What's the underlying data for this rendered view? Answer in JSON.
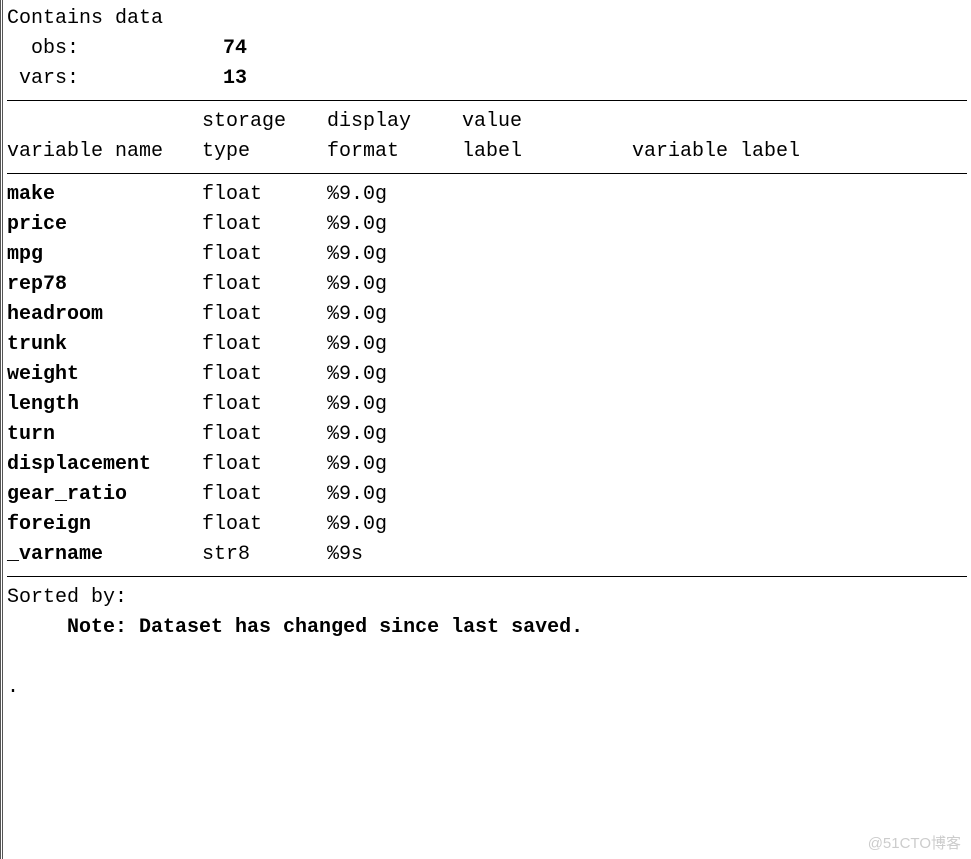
{
  "header": {
    "title": "Contains data",
    "obs_label": "  obs:",
    "obs_value": "74",
    "vars_label": " vars:",
    "vars_value": "13"
  },
  "col_headers": {
    "line1": {
      "c1": "",
      "c2": "storage",
      "c3": "display",
      "c4": "value",
      "c5": ""
    },
    "line2": {
      "c1": "variable name",
      "c2": "type",
      "c3": "format",
      "c4": "label",
      "c5": "variable label"
    }
  },
  "variables": [
    {
      "name": "make",
      "type": "float",
      "format": "%9.0g",
      "vlabel": "",
      "varlabel": ""
    },
    {
      "name": "price",
      "type": "float",
      "format": "%9.0g",
      "vlabel": "",
      "varlabel": ""
    },
    {
      "name": "mpg",
      "type": "float",
      "format": "%9.0g",
      "vlabel": "",
      "varlabel": ""
    },
    {
      "name": "rep78",
      "type": "float",
      "format": "%9.0g",
      "vlabel": "",
      "varlabel": ""
    },
    {
      "name": "headroom",
      "type": "float",
      "format": "%9.0g",
      "vlabel": "",
      "varlabel": ""
    },
    {
      "name": "trunk",
      "type": "float",
      "format": "%9.0g",
      "vlabel": "",
      "varlabel": ""
    },
    {
      "name": "weight",
      "type": "float",
      "format": "%9.0g",
      "vlabel": "",
      "varlabel": ""
    },
    {
      "name": "length",
      "type": "float",
      "format": "%9.0g",
      "vlabel": "",
      "varlabel": ""
    },
    {
      "name": "turn",
      "type": "float",
      "format": "%9.0g",
      "vlabel": "",
      "varlabel": ""
    },
    {
      "name": "displacement",
      "type": "float",
      "format": "%9.0g",
      "vlabel": "",
      "varlabel": ""
    },
    {
      "name": "gear_ratio",
      "type": "float",
      "format": "%9.0g",
      "vlabel": "",
      "varlabel": ""
    },
    {
      "name": "foreign",
      "type": "float",
      "format": "%9.0g",
      "vlabel": "",
      "varlabel": ""
    },
    {
      "name": "_varname",
      "type": "str8",
      "format": "%9s",
      "vlabel": "",
      "varlabel": ""
    }
  ],
  "footer": {
    "sorted_by": "Sorted by:",
    "note_label": "     Note: ",
    "note_text": "Dataset has changed since last saved."
  },
  "prompt": ".",
  "watermark": "@51CTO博客"
}
